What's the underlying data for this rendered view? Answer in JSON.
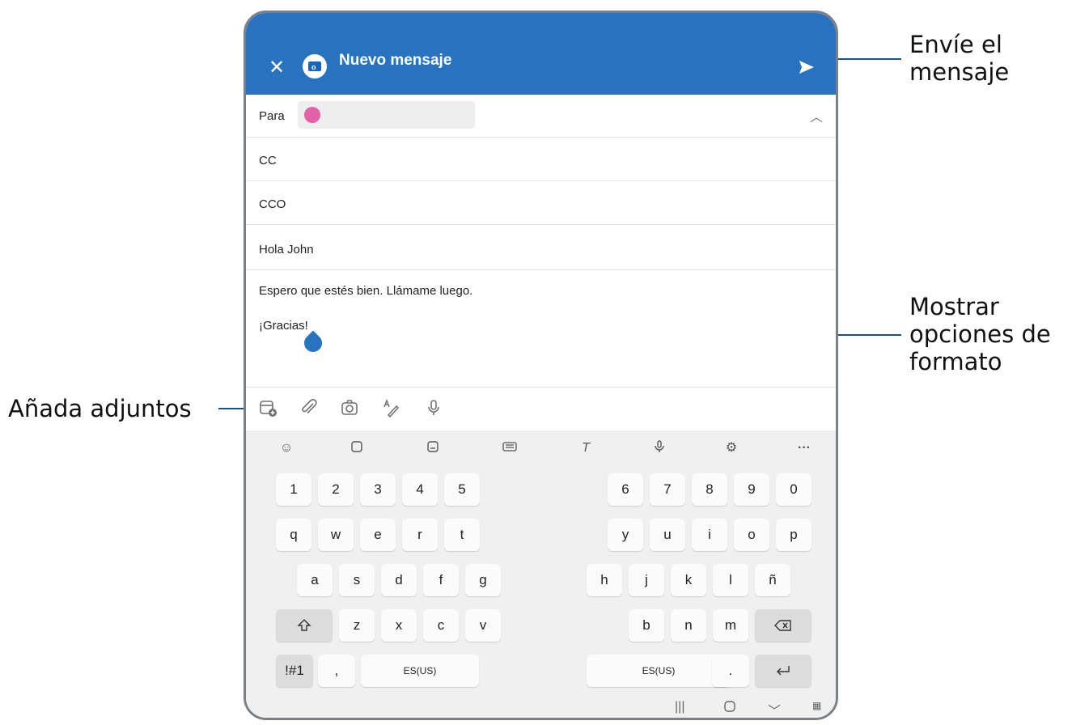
{
  "callouts": {
    "send": "Envíe el mensaje",
    "send_line1": "Envíe el",
    "send_line2": "mensaje",
    "format_line1": "Mostrar",
    "format_line2": "opciones de",
    "format_line3": "formato",
    "attach": "Añada adjuntos"
  },
  "app": {
    "title": "Nuevo mensaje",
    "close_icon": "close-icon",
    "send_icon": "send-icon",
    "accent": "#2872bf"
  },
  "fields": {
    "to_label": "Para",
    "cc_label": "CC",
    "bcc_label": "CCO",
    "subject": "Hola John"
  },
  "message": {
    "line1": "Espero que estés bien. Llámame luego.",
    "line2": "¡Gracias!"
  },
  "keyboard": {
    "row_numbers_left": [
      "1",
      "2",
      "3",
      "4",
      "5"
    ],
    "row_numbers_right": [
      "6",
      "7",
      "8",
      "9",
      "0"
    ],
    "row_q_left": [
      "q",
      "w",
      "e",
      "r",
      "t"
    ],
    "row_q_right": [
      "y",
      "u",
      "i",
      "o",
      "p"
    ],
    "row_a_left": [
      "a",
      "s",
      "d",
      "f",
      "g"
    ],
    "row_a_right": [
      "h",
      "j",
      "k",
      "l",
      "ñ"
    ],
    "row_z_left": [
      "z",
      "x",
      "c",
      "v"
    ],
    "row_z_right": [
      "b",
      "n",
      "m"
    ],
    "symbols_key": "!#1",
    "comma_key": ",",
    "space_left": "ES(US)",
    "space_right": "ES(US)",
    "period_key": "."
  }
}
